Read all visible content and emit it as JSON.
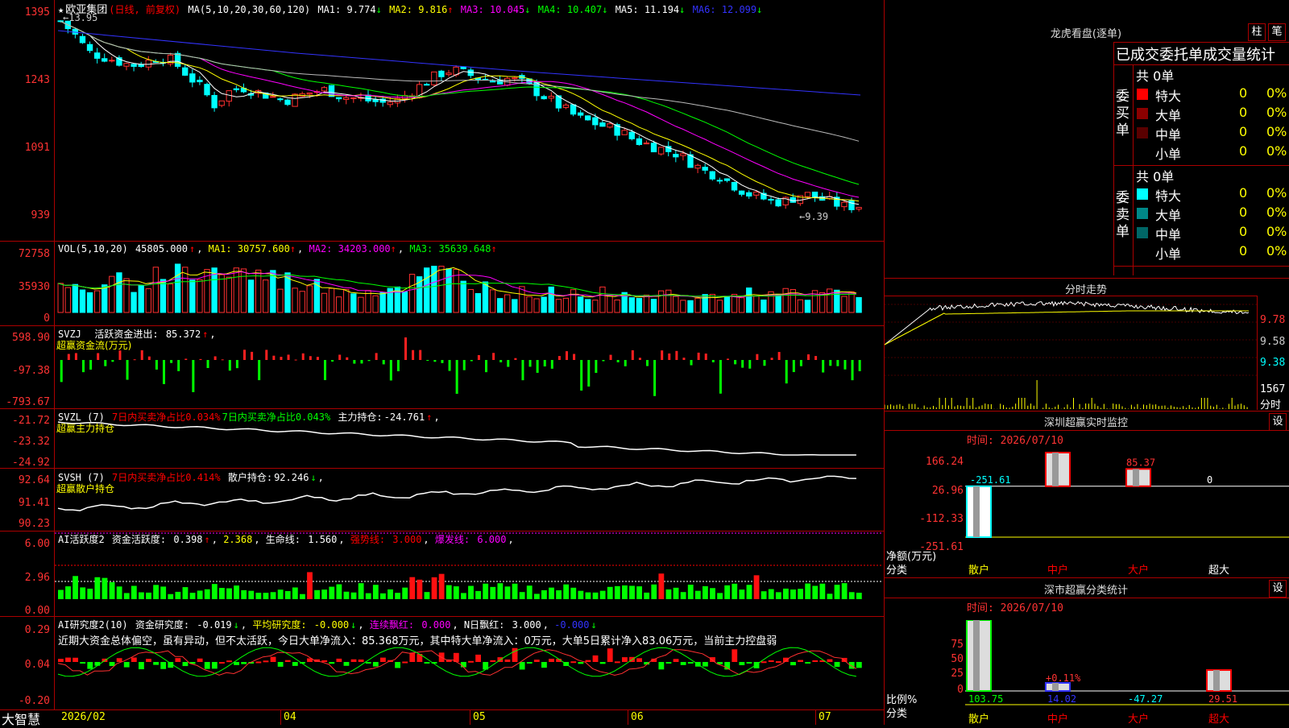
{
  "stock": {
    "star": "★",
    "name": "欧亚集团",
    "period": "(日线, 前复权)",
    "ma_prefix": "MA(5,10,20,30,60,120)",
    "ma": [
      {
        "label": "MA1:",
        "value": "9.774",
        "arrow": "↓",
        "color": "#ffffff"
      },
      {
        "label": "MA2:",
        "value": "9.816",
        "arrow": "↑",
        "color": "#ffff00"
      },
      {
        "label": "MA3:",
        "value": "10.045",
        "arrow": "↓",
        "color": "#ff00ff"
      },
      {
        "label": "MA4:",
        "value": "10.407",
        "arrow": "↓",
        "color": "#00ff00"
      },
      {
        "label": "MA5:",
        "value": "11.194",
        "arrow": "↓",
        "color": "#cccccc"
      },
      {
        "label": "MA6:",
        "value": "12.099",
        "arrow": "↓",
        "color": "#3333ff"
      }
    ],
    "high_marker": "13.95",
    "low_marker": "9.39",
    "y_labels": [
      "1395",
      "1243",
      "1091",
      "939"
    ],
    "dates": [
      "2026/02",
      "04",
      "05",
      "06",
      "07"
    ],
    "brand": "大智慧"
  },
  "vol": {
    "title": "VOL(5,10,20)",
    "value": "45805.000",
    "arrow": "↑",
    "ma": [
      {
        "label": "MA1:",
        "value": "30757.600",
        "arrow": "↑",
        "color": "#ffff00"
      },
      {
        "label": "MA2:",
        "value": "34203.000",
        "arrow": "↑",
        "color": "#ff00ff"
      },
      {
        "label": "MA3:",
        "value": "35639.648",
        "arrow": "↑",
        "color": "#00ff00"
      }
    ],
    "y_labels": [
      "72758",
      "35930",
      "0"
    ]
  },
  "svzj": {
    "title": "SVZJ",
    "label": "活跃资金进出:",
    "value": "85.372",
    "arrow": "↑",
    "sub": "超赢资金流(万元)",
    "y_labels": [
      "598.90",
      "-97.38",
      "-793.67"
    ]
  },
  "svzl": {
    "title": "SVZL (7)",
    "t1": "7日内买卖净占比0.034%",
    "t2": "7日内买卖净占比0.043%",
    "t3": "主力持仓:",
    "value": "-24.761",
    "arrow": "↑",
    "sub": "超赢主力持仓",
    "y_labels": [
      "-21.72",
      "-23.32",
      "-24.92"
    ]
  },
  "svsh": {
    "title": "SVSH (7)",
    "t1": "7日内买卖净占比0.414%",
    "t3": "散户持仓:",
    "value": "92.246",
    "arrow": "↓",
    "sub": "超赢散户持仓",
    "y_labels": [
      "92.64",
      "91.41",
      "90.23"
    ]
  },
  "ai_active": {
    "title": "AI活跃度2",
    "label": "资金活跃度:",
    "v1": "0.398",
    "v2": "2.368",
    "l3": "生命线:",
    "v3": "1.560",
    "l4": "强势线:",
    "v4": "3.000",
    "l5": "爆发线:",
    "v5": "6.000",
    "y_labels": [
      "6.00",
      "2.96",
      "0.00"
    ]
  },
  "ai_research": {
    "title": "AI研究度2(10)",
    "l1": "资金研究度:",
    "v1": "-0.019",
    "l2": "平均研究度:",
    "v2": "-0.000",
    "l3": "连续飘红:",
    "v3": "0.000",
    "l4": "N日飘红:",
    "v4": "3.000",
    "v5": "-0.000",
    "comment": "近期大资金总体偏空，虽有异动，但不太活跃，今日大单净流入：85.368万元，其中特大单净流入：0万元，大单5日累计净入83.06万元，当前主力控盘弱",
    "y_labels": [
      "0.29",
      "0.04",
      "-0.20"
    ]
  },
  "dragon": {
    "title": "龙虎看盘(逐单)",
    "btn1": "柱",
    "btn2": "笔",
    "header": "已成交委托单成交量统计",
    "buy_label": "委买单",
    "sell_label": "委卖单",
    "buy_total": "共 0单",
    "sell_total": "共 0单",
    "buy_rows": [
      {
        "name": "特大",
        "count": "0",
        "pct": "0%",
        "color": "#ff0000"
      },
      {
        "name": "大单",
        "count": "0",
        "pct": "0%",
        "color": "#8b0000"
      },
      {
        "name": "中单",
        "count": "0",
        "pct": "0%",
        "color": "#5a0000"
      },
      {
        "name": "小单",
        "count": "0",
        "pct": "0%",
        "color": "#000000"
      }
    ],
    "sell_rows": [
      {
        "name": "特大",
        "count": "0",
        "pct": "0%",
        "color": "#00ffff"
      },
      {
        "name": "大单",
        "count": "0",
        "pct": "0%",
        "color": "#008888"
      },
      {
        "name": "中单",
        "count": "0",
        "pct": "0%",
        "color": "#006666"
      },
      {
        "name": "小单",
        "count": "0",
        "pct": "0%",
        "color": "#000000"
      }
    ]
  },
  "intraday": {
    "title": "分时走势",
    "y_labels": [
      "9.78",
      "9.58",
      "9.38"
    ],
    "vol_label": "1567",
    "unit": "分时"
  },
  "sz_monitor": {
    "title": "深圳超赢实时监控",
    "btn": "设",
    "time": "时间: 2026/07/10",
    "y_labels": [
      "166.24",
      "26.96",
      "-112.33",
      "-251.61"
    ],
    "unit": "净额(万元)",
    "cat_label": "分类",
    "categories": [
      "散户",
      "中户",
      "大户",
      "超大"
    ],
    "values_text": [
      "-251.61",
      "166.24",
      "85.37",
      "0"
    ]
  },
  "sz_class": {
    "title": "深市超赢分类统计",
    "btn": "设",
    "time": "时间: 2026/07/10",
    "y_labels": [
      "75",
      "50",
      "25",
      "0"
    ],
    "unit": "比例%",
    "cat_label": "分类",
    "categories": [
      "散户",
      "中户",
      "大户",
      "超大"
    ],
    "values_text": [
      "103.75",
      "14.02",
      "-47.27",
      "29.51"
    ],
    "extra": "+0.11%"
  },
  "chart_data": [
    {
      "type": "candlestick",
      "title": "欧亚集团 (日线, 前复权)",
      "x_range": [
        "2026/02",
        "2026/07"
      ],
      "ylim": [
        9.39,
        13.95
      ],
      "y_ticks": [
        13.95,
        12.43,
        10.91,
        9.39
      ],
      "close_points": [
        13.8,
        13.5,
        13.1,
        13.0,
        12.9,
        12.8,
        12.85,
        13.0,
        12.9,
        12.6,
        12.3,
        11.9,
        12.2,
        12.3,
        12.2,
        12.1,
        12.0,
        12.1,
        12.2,
        12.25,
        12.1,
        12.05,
        12.0,
        11.95,
        12.0,
        12.2,
        12.4,
        12.6,
        12.7,
        12.6,
        12.5,
        12.45,
        12.5,
        12.4,
        12.2,
        12.0,
        11.8,
        11.6,
        11.5,
        11.4,
        11.3,
        11.1,
        11.0,
        10.9,
        10.8,
        10.6,
        10.4,
        10.3,
        10.1,
        9.9,
        9.8,
        9.7,
        9.75,
        9.9,
        9.8,
        9.7,
        9.6,
        9.62
      ],
      "ma_last": {
        "MA1": 9.774,
        "MA2": 9.816,
        "MA3": 10.045,
        "MA4": 10.407,
        "MA5": 11.194,
        "MA6": 12.099
      }
    },
    {
      "type": "bar",
      "title": "VOL(5,10,20)",
      "ylim": [
        0,
        72758
      ],
      "last_value": 45805
    },
    {
      "type": "bar",
      "title": "深圳超赢实时监控",
      "categories": [
        "散户",
        "中户",
        "大户",
        "超大"
      ],
      "values": [
        -251.61,
        166.24,
        85.37,
        0
      ],
      "ylim": [
        -251.61,
        166.24
      ]
    },
    {
      "type": "bar",
      "title": "深市超赢分类统计",
      "categories": [
        "散户",
        "中户",
        "大户",
        "超大"
      ],
      "values": [
        103.75,
        14.02,
        -47.27,
        29.51
      ],
      "ylim": [
        0,
        100
      ]
    }
  ]
}
